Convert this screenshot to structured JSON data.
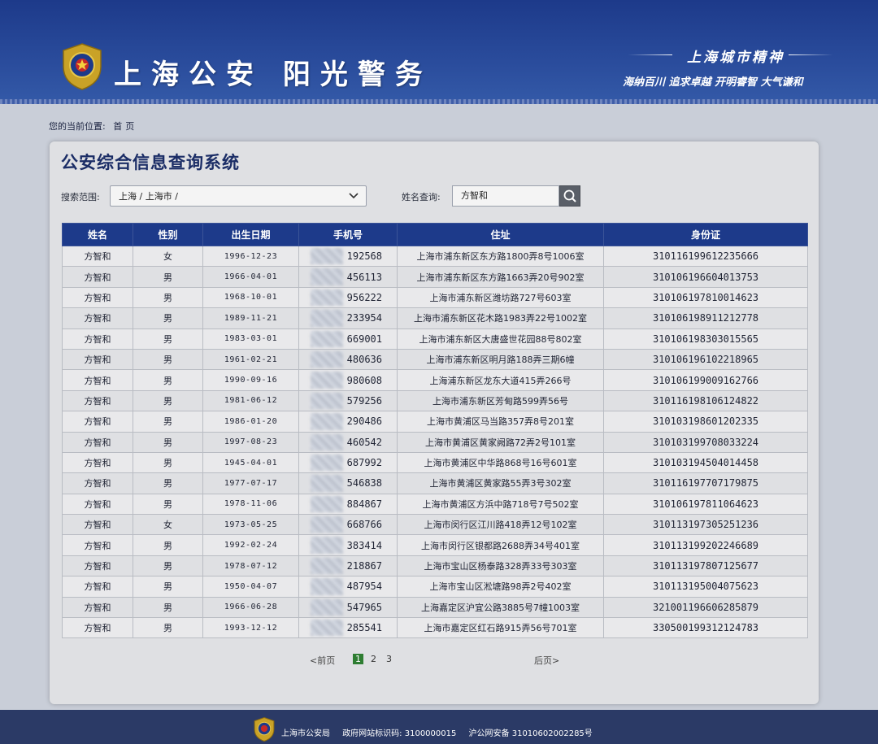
{
  "header": {
    "title": "上海公安 阳光警务",
    "slogan_title": "上海城市精神",
    "slogan_text": "海纳百川 追求卓越 开明睿智 大气谦和"
  },
  "breadcrumb": {
    "prefix": "您的当前位置:",
    "current": "首页"
  },
  "panel": {
    "title": "公安综合信息查询系统",
    "scope_label": "搜索范围:",
    "scope_value": "上海 / 上海市 /",
    "name_label": "姓名查询:",
    "name_value": "方智和"
  },
  "table": {
    "headers": [
      "姓名",
      "性别",
      "出生日期",
      "手机号",
      "住址",
      "身份证"
    ],
    "rows": [
      [
        "方智和",
        "女",
        "1996-12-23",
        "192568",
        "上海市浦东新区东方路1800弄8号1006室",
        "310116199612235666"
      ],
      [
        "方智和",
        "男",
        "1966-04-01",
        "456113",
        "上海市浦东新区东方路1663弄20号902室",
        "310106196604013753"
      ],
      [
        "方智和",
        "男",
        "1968-10-01",
        "956222",
        "上海市浦东新区潍坊路727号603室",
        "310106197810014623"
      ],
      [
        "方智和",
        "男",
        "1989-11-21",
        "233954",
        "上海市浦东新区花木路1983弄22号1002室",
        "310106198911212778"
      ],
      [
        "方智和",
        "男",
        "1983-03-01",
        "669001",
        "上海市浦东新区大唐盛世花园88号802室",
        "310106198303015565"
      ],
      [
        "方智和",
        "男",
        "1961-02-21",
        "480636",
        "上海市浦东新区明月路188弄三期6幢",
        "310106196102218965"
      ],
      [
        "方智和",
        "男",
        "1990-09-16",
        "980608",
        "上海浦东新区龙东大道415弄266号",
        "310106199009162766"
      ],
      [
        "方智和",
        "男",
        "1981-06-12",
        "579256",
        "上海市浦东新区芳甸路599弄56号",
        "310116198106124822"
      ],
      [
        "方智和",
        "男",
        "1986-01-20",
        "290486",
        "上海市黄浦区马当路357弄8号201室",
        "310103198601202335"
      ],
      [
        "方智和",
        "男",
        "1997-08-23",
        "460542",
        "上海市黄浦区黄家阙路72弄2号101室",
        "310103199708033224"
      ],
      [
        "方智和",
        "男",
        "1945-04-01",
        "687992",
        "上海市黄浦区中华路868号16号601室",
        "310103194504014458"
      ],
      [
        "方智和",
        "男",
        "1977-07-17",
        "546838",
        "上海市黄浦区黄家路55弄3号302室",
        "310116197707179875"
      ],
      [
        "方智和",
        "男",
        "1978-11-06",
        "884867",
        "上海市黄浦区方浜中路718号7号502室",
        "310106197811064623"
      ],
      [
        "方智和",
        "女",
        "1973-05-25",
        "668766",
        "上海市闵行区江川路418弄12号102室",
        "310113197305251236"
      ],
      [
        "方智和",
        "男",
        "1992-02-24",
        "383414",
        "上海市闵行区银都路2688弄34号401室",
        "310113199202246689"
      ],
      [
        "方智和",
        "男",
        "1978-07-12",
        "218867",
        "上海市宝山区杨泰路328弄33号303室",
        "310113197807125677"
      ],
      [
        "方智和",
        "男",
        "1950-04-07",
        "487954",
        "上海市宝山区淞塘路98弄2号402室",
        "310113195004075623"
      ],
      [
        "方智和",
        "男",
        "1966-06-28",
        "547965",
        "上海嘉定区沪宜公路3885号7幢1003室",
        "321001196606285879"
      ],
      [
        "方智和",
        "男",
        "1993-12-12",
        "285541",
        "上海市嘉定区红石路915弄56号701室",
        "330500199312124783"
      ]
    ]
  },
  "pagination": {
    "prev": "<前页",
    "pages": [
      "1",
      "2",
      "3"
    ],
    "current": "1",
    "next": "后页>"
  },
  "footer": {
    "org": "上海市公安局",
    "site_code": "政府网站标识码: 3100000015",
    "record": "沪公网安备 31010602002285号"
  }
}
